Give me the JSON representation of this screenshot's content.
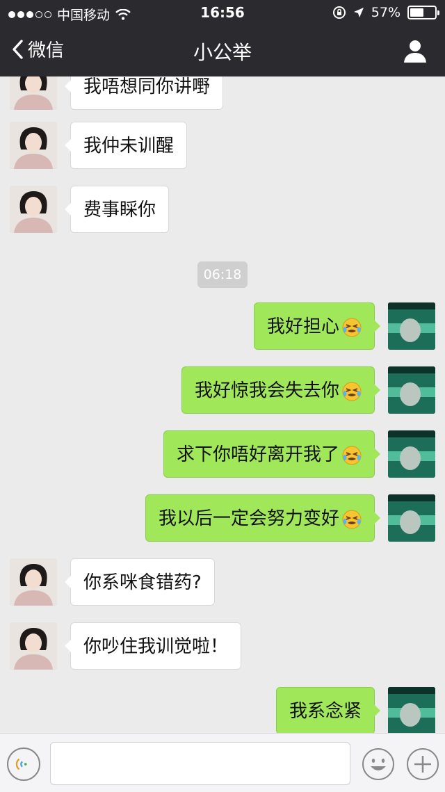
{
  "status_bar": {
    "carrier": "中国移动",
    "time": "16:56",
    "battery_text": "57%",
    "battery_level": 0.57
  },
  "nav": {
    "back_label": "微信",
    "title": "小公举"
  },
  "messages": [
    {
      "side": "in",
      "text": "我唔想同你讲嘢"
    },
    {
      "side": "in",
      "text": "我仲未训醒"
    },
    {
      "side": "in",
      "text": "费事睬你"
    },
    {
      "side": "out",
      "text": "我好担心"
    },
    {
      "side": "out",
      "text": "我好惊我会失去你"
    },
    {
      "side": "out",
      "text": "求下你唔好离开我了"
    },
    {
      "side": "out",
      "text": "我以后一定会努力变好"
    },
    {
      "side": "in",
      "text": "你系咪食错药?"
    },
    {
      "side": "in",
      "text": "你吵住我训觉啦！"
    },
    {
      "side": "out",
      "text": "我系念紧"
    }
  ],
  "timestamp": "06:18",
  "input": {
    "value": "",
    "placeholder": ""
  },
  "icons": {
    "back": "chevron-left-icon",
    "profile": "person-icon",
    "voice": "voice-icon",
    "emoji": "emoji-icon",
    "plus": "plus-icon",
    "emoji_in_message": "crying-face-icon"
  },
  "colors": {
    "nav_bg": "#2b2b2f",
    "chat_bg": "#ebebeb",
    "incoming_bubble": "#ffffff",
    "outgoing_bubble": "#a0e75a"
  }
}
